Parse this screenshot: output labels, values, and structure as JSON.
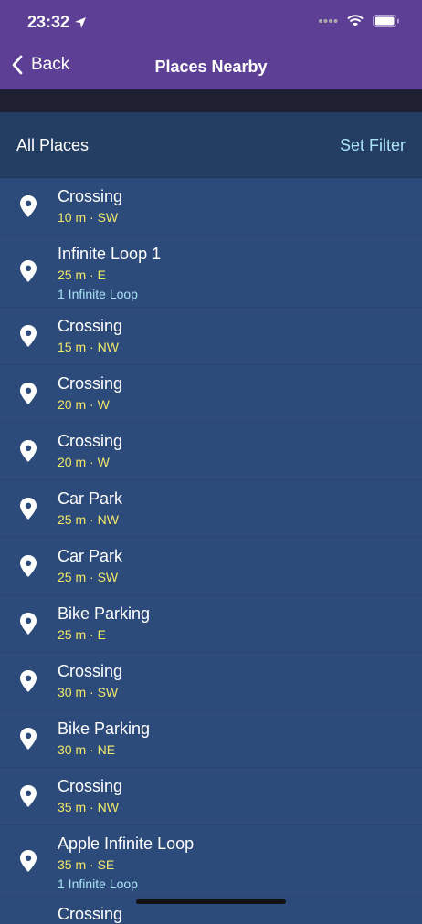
{
  "status": {
    "time": "23:32"
  },
  "nav": {
    "back_label": "Back",
    "title": "Places Nearby"
  },
  "filter": {
    "label": "All Places",
    "action": "Set Filter"
  },
  "places": [
    {
      "name": "Crossing",
      "distance": "10 m",
      "direction": "SW",
      "address": null
    },
    {
      "name": "Infinite Loop 1",
      "distance": "25 m",
      "direction": "E",
      "address": "1 Infinite Loop"
    },
    {
      "name": "Crossing",
      "distance": "15 m",
      "direction": "NW",
      "address": null
    },
    {
      "name": "Crossing",
      "distance": "20 m",
      "direction": "W",
      "address": null
    },
    {
      "name": "Crossing",
      "distance": "20 m",
      "direction": "W",
      "address": null
    },
    {
      "name": "Car Park",
      "distance": "25 m",
      "direction": "NW",
      "address": null
    },
    {
      "name": "Car Park",
      "distance": "25 m",
      "direction": "SW",
      "address": null
    },
    {
      "name": "Bike Parking",
      "distance": "25 m",
      "direction": "E",
      "address": null
    },
    {
      "name": "Crossing",
      "distance": "30 m",
      "direction": "SW",
      "address": null
    },
    {
      "name": "Bike Parking",
      "distance": "30 m",
      "direction": "NE",
      "address": null
    },
    {
      "name": "Crossing",
      "distance": "35 m",
      "direction": "NW",
      "address": null
    },
    {
      "name": "Apple Infinite Loop",
      "distance": "35 m",
      "direction": "SE",
      "address": "1 Infinite Loop"
    }
  ],
  "partial_row_label": "Crossing",
  "colors": {
    "header": "#5d3f96",
    "list_bg": "#2c4a7a",
    "meta": "#f2e86a",
    "link": "#a9e3f5"
  },
  "icons": {
    "pin": "map-pin-icon",
    "back": "chevron-left-icon",
    "location": "location-arrow-icon"
  }
}
